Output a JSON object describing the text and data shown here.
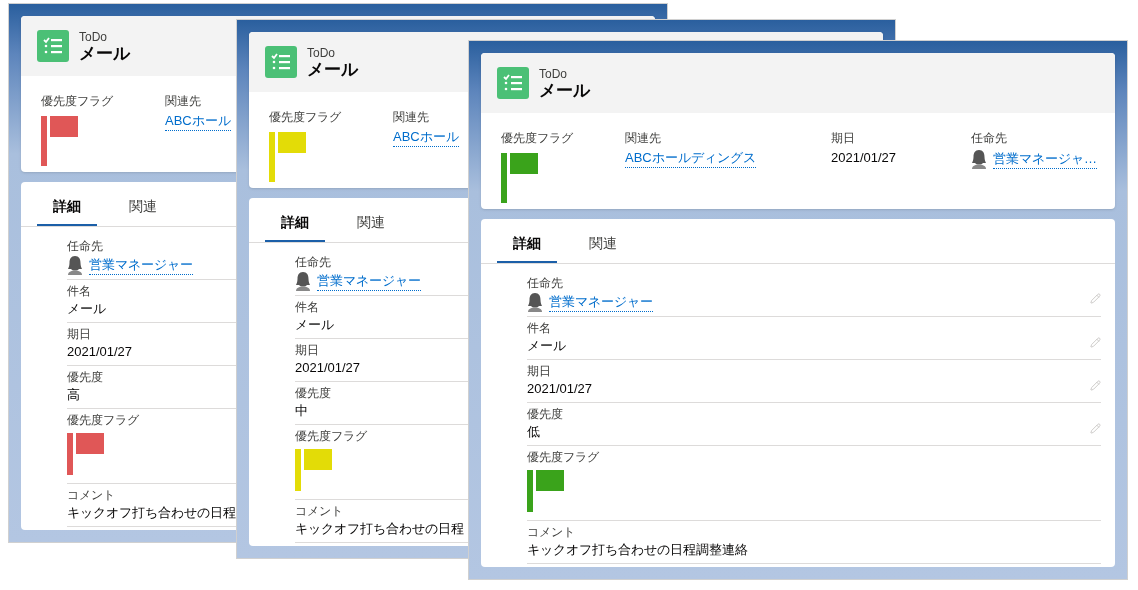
{
  "windows": [
    {
      "object_type": "ToDo",
      "title": "メール",
      "edit_icons": false,
      "highlights": [
        {
          "kind": "flag",
          "label": "優先度フラグ",
          "color": "#e05757"
        },
        {
          "kind": "link",
          "label": "関連先",
          "value": "ABCホール"
        }
      ],
      "tabs": [
        {
          "label": "詳細",
          "selected": true
        },
        {
          "label": "関連",
          "selected": false
        }
      ],
      "fields": [
        {
          "kind": "user",
          "label": "任命先",
          "value": "営業マネージャー"
        },
        {
          "kind": "text",
          "label": "件名",
          "value": "メール"
        },
        {
          "kind": "text",
          "label": "期日",
          "value": "2021/01/27"
        },
        {
          "kind": "text",
          "label": "優先度",
          "value": "高"
        },
        {
          "kind": "flag",
          "label": "優先度フラグ",
          "color": "#e05757"
        },
        {
          "kind": "text",
          "label": "コメント",
          "value": "キックオフ打ち合わせの日程"
        }
      ]
    },
    {
      "object_type": "ToDo",
      "title": "メール",
      "edit_icons": false,
      "highlights": [
        {
          "kind": "flag",
          "label": "優先度フラグ",
          "color": "#e3dc07"
        },
        {
          "kind": "link",
          "label": "関連先",
          "value": "ABCホール"
        }
      ],
      "tabs": [
        {
          "label": "詳細",
          "selected": true
        },
        {
          "label": "関連",
          "selected": false
        }
      ],
      "fields": [
        {
          "kind": "user",
          "label": "任命先",
          "value": "営業マネージャー"
        },
        {
          "kind": "text",
          "label": "件名",
          "value": "メール"
        },
        {
          "kind": "text",
          "label": "期日",
          "value": "2021/01/27"
        },
        {
          "kind": "text",
          "label": "優先度",
          "value": "中"
        },
        {
          "kind": "flag",
          "label": "優先度フラグ",
          "color": "#e3dc07"
        },
        {
          "kind": "text",
          "label": "コメント",
          "value": "キックオフ打ち合わせの日程"
        }
      ]
    },
    {
      "object_type": "ToDo",
      "title": "メール",
      "edit_icons": true,
      "highlights": [
        {
          "kind": "flag",
          "label": "優先度フラグ",
          "color": "#3aa31b"
        },
        {
          "kind": "link",
          "label": "関連先",
          "value": "ABCホールディングス"
        },
        {
          "kind": "text",
          "label": "期日",
          "value": "2021/01/27"
        },
        {
          "kind": "user",
          "label": "任命先",
          "value": "営業マネージャ…"
        }
      ],
      "tabs": [
        {
          "label": "詳細",
          "selected": true
        },
        {
          "label": "関連",
          "selected": false
        }
      ],
      "fields": [
        {
          "kind": "user",
          "label": "任命先",
          "value": "営業マネージャー"
        },
        {
          "kind": "text",
          "label": "件名",
          "value": "メール"
        },
        {
          "kind": "text",
          "label": "期日",
          "value": "2021/01/27"
        },
        {
          "kind": "text",
          "label": "優先度",
          "value": "低"
        },
        {
          "kind": "flag",
          "label": "優先度フラグ",
          "color": "#3aa31b"
        },
        {
          "kind": "text",
          "label": "コメント",
          "value": "キックオフ打ち合わせの日程調整連絡"
        }
      ]
    }
  ]
}
